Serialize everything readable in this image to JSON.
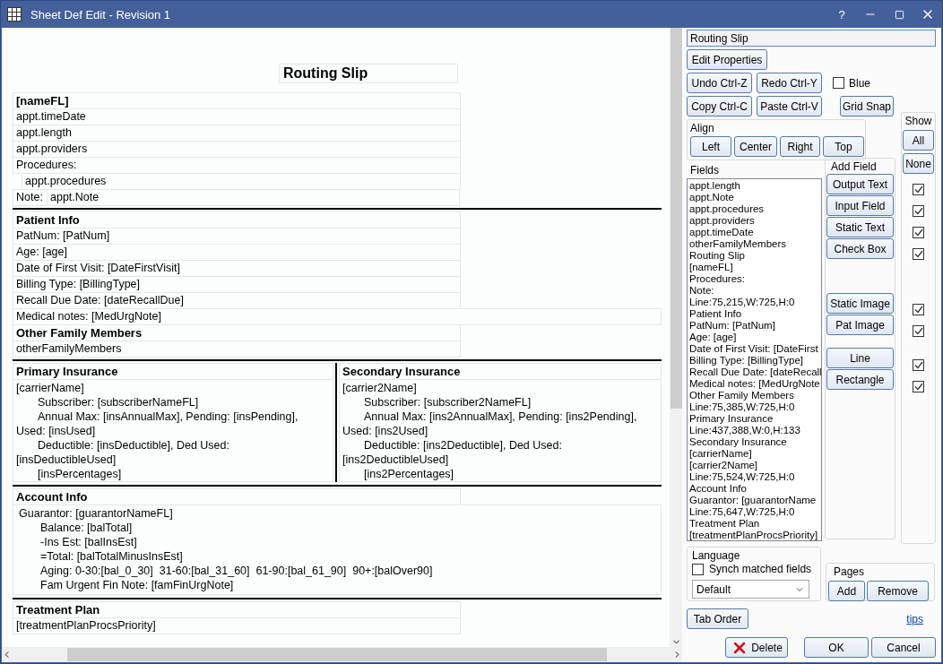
{
  "window": {
    "title": "Sheet Def Edit - Revision 1",
    "help": "?"
  },
  "canvas": {
    "items": [
      {
        "kind": "title",
        "text": "Routing Slip"
      },
      {
        "kind": "heading",
        "text": "[nameFL]"
      },
      {
        "kind": "field",
        "text": "appt.timeDate"
      },
      {
        "kind": "field",
        "text": "appt.length"
      },
      {
        "kind": "field",
        "text": "appt.providers"
      },
      {
        "kind": "field",
        "text": "Procedures:"
      },
      {
        "kind": "indented",
        "text": "appt.procedures"
      },
      {
        "kind": "pair",
        "label": "Note:",
        "text": "appt.Note"
      },
      {
        "kind": "line"
      },
      {
        "kind": "heading",
        "text": "Patient Info"
      },
      {
        "kind": "field",
        "text": "PatNum: [PatNum]"
      },
      {
        "kind": "field",
        "text": "Age: [age]"
      },
      {
        "kind": "field",
        "text": "Date of First Visit: [DateFirstVisit]"
      },
      {
        "kind": "field",
        "text": "Billing Type: [BillingType]"
      },
      {
        "kind": "field",
        "text": "Recall Due Date: [dateRecallDue]"
      },
      {
        "kind": "wide",
        "text": "Medical notes: [MedUrgNote]"
      },
      {
        "kind": "heading",
        "text": "Other Family Members"
      },
      {
        "kind": "field",
        "text": "otherFamilyMembers"
      },
      {
        "kind": "line"
      },
      {
        "kind": "columns",
        "columns": [
          {
            "heading": "Primary Insurance",
            "body": [
              {
                "kind": "plain",
                "text": "[carrierName]"
              },
              {
                "kind": "indented",
                "text": "Subscriber: [subscriberNameFL]"
              },
              {
                "kind": "indented",
                "text": "Annual Max: [insAnnualMax], Pending: [insPending], Used: [insUsed]"
              },
              {
                "kind": "indented",
                "text": "Deductible: [insDeductible], Ded Used: [insDeductibleUsed]"
              },
              {
                "kind": "indented",
                "text": "[insPercentages]"
              }
            ]
          },
          {
            "heading": "Secondary Insurance",
            "body": [
              {
                "kind": "plain",
                "text": "[carrier2Name]"
              },
              {
                "kind": "indented",
                "text": "Subscriber: [subscriber2NameFL]"
              },
              {
                "kind": "indented",
                "text": "Annual Max: [ins2AnnualMax], Pending: [ins2Pending], Used: [ins2Used]"
              },
              {
                "kind": "indented",
                "text": "Deductible: [ins2Deductible], Ded Used: [ins2DeductibleUsed]"
              },
              {
                "kind": "indented",
                "text": "[ins2Percentages]"
              }
            ]
          }
        ]
      },
      {
        "kind": "line"
      },
      {
        "kind": "heading",
        "text": "Account Info"
      },
      {
        "kind": "block",
        "body": [
          {
            "kind": "plain",
            "text": "Guarantor: [guarantorNameFL]"
          },
          {
            "kind": "indented",
            "text": "Balance: [balTotal]"
          },
          {
            "kind": "indented",
            "text": "-Ins Est: [balInsEst]"
          },
          {
            "kind": "indented",
            "text": "=Total: [balTotalMinusInsEst]"
          },
          {
            "kind": "indented",
            "text": "Aging: 0-30:[bal_0_30]  31-60:[bal_31_60]  61-90:[bal_61_90]  90+:[balOver90]"
          },
          {
            "kind": "indented",
            "text": "Fam Urgent Fin Note: [famFinUrgNote]"
          }
        ]
      },
      {
        "kind": "line"
      },
      {
        "kind": "heading",
        "text": "Treatment Plan"
      },
      {
        "kind": "field",
        "text": "[treatmentPlanProcsPriority]"
      }
    ]
  },
  "panel": {
    "name_value": "Routing Slip",
    "edit_properties": "Edit Properties",
    "undo": "Undo Ctrl-Z",
    "redo": "Redo Ctrl-Y",
    "blue": {
      "label": "Blue",
      "checked": false
    },
    "copy": "Copy Ctrl-C",
    "paste": "Paste Ctrl-V",
    "grid_snap": "Grid Snap",
    "align": {
      "label": "Align",
      "buttons": [
        "Left",
        "Center",
        "Right",
        "Top"
      ]
    },
    "fields": {
      "label": "Fields",
      "items": [
        "appt.length",
        "appt.Note",
        "appt.procedures",
        "appt.providers",
        "appt.timeDate",
        "otherFamilyMembers",
        "Routing Slip",
        "[nameFL]",
        "Procedures:",
        "Note:",
        "Line:75,215,W:725,H:0",
        "Patient Info",
        "PatNum: [PatNum]",
        "Age: [age]",
        "Date of First Visit: [DateFirst",
        "Billing Type: [BillingType]",
        "Recall Due Date: [dateRecall",
        "Medical notes: [MedUrgNote",
        "Other Family Members",
        "Line:75,385,W:725,H:0",
        "Primary Insurance",
        "Line:437,388,W:0,H:133",
        "Secondary Insurance",
        "[carrierName]",
        "[carrier2Name]",
        "Line:75,524,W:725,H:0",
        "Account Info",
        "Guarantor: [guarantorName",
        "Line:75,647,W:725,H:0",
        "Treatment Plan",
        "[treatmentPlanProcsPriority]"
      ]
    },
    "add_field": {
      "label": "Add Field",
      "groups": [
        [
          {
            "label": "Output Text",
            "show": true
          },
          {
            "label": "Input Field",
            "show": true
          },
          {
            "label": "Static Text",
            "show": true
          },
          {
            "label": "Check Box",
            "show": true
          }
        ],
        [
          {
            "label": "Static Image",
            "show": true
          },
          {
            "label": "Pat Image",
            "show": true
          }
        ],
        [
          {
            "label": "Line",
            "show": true
          },
          {
            "label": "Rectangle",
            "show": true
          }
        ]
      ]
    },
    "show": {
      "label": "Show",
      "all": "All",
      "none": "None"
    },
    "language": {
      "label": "Language",
      "synch": {
        "label": "Synch matched fields",
        "checked": false
      },
      "value": "Default"
    },
    "pages": {
      "label": "Pages",
      "add": "Add",
      "remove": "Remove"
    },
    "tab_order": "Tab Order",
    "tips": "tips",
    "buttons": {
      "delete": "Delete",
      "ok": "OK",
      "cancel": "Cancel"
    }
  }
}
